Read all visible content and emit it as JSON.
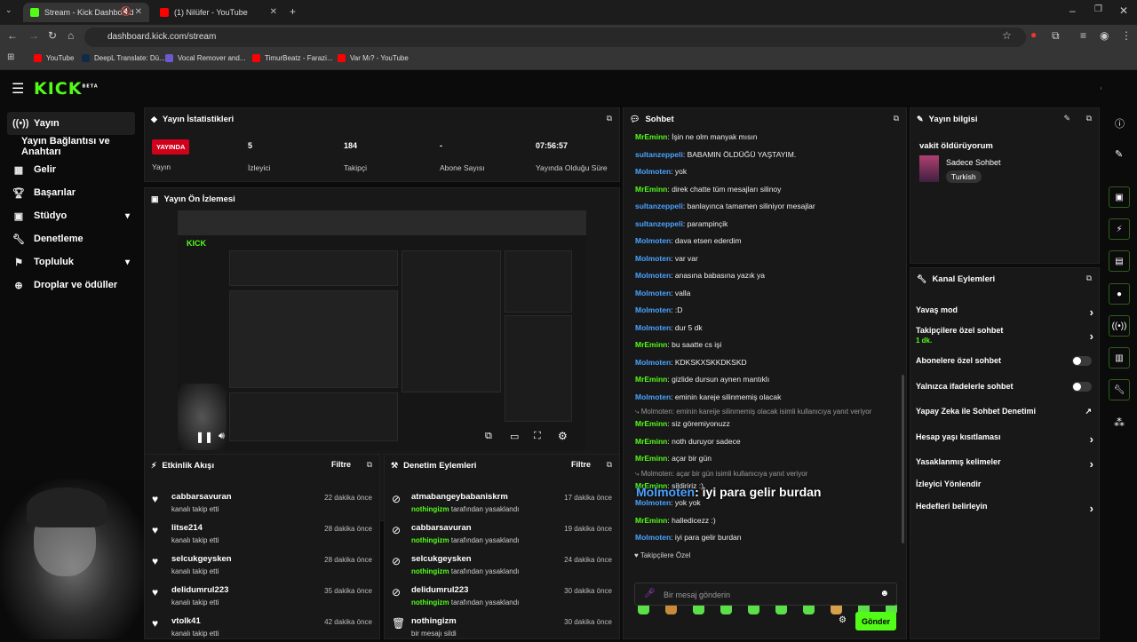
{
  "browser": {
    "tabs": [
      {
        "title": "Stream - Kick Dashboard",
        "active": true,
        "color": "#53fc18"
      },
      {
        "title": "(1) Nilüfer - YouTube",
        "active": false,
        "color": "#ff0000"
      }
    ],
    "url": "dashboard.kick.com/stream",
    "bookmarks": [
      "YouTube",
      "DeepL Translate: Dü...",
      "Vocal Remover and...",
      "TimurBeatz - Farazi...",
      "Var Mı? - YouTube"
    ]
  },
  "logo": {
    "text": "KICK",
    "beta": "BETA"
  },
  "sidebar": {
    "items": [
      {
        "label": "Yayın",
        "icon": "stream-icon",
        "selected": true
      },
      {
        "label": "Yayın Bağlantısı ve Anahtarı",
        "icon": "",
        "selected": false
      },
      {
        "label": "Gelir",
        "icon": "chart-icon"
      },
      {
        "label": "Başarılar",
        "icon": "trophy-icon"
      },
      {
        "label": "Stüdyo",
        "icon": "studio-icon",
        "chevron": true
      },
      {
        "label": "Denetleme",
        "icon": "wrench-icon"
      },
      {
        "label": "Topluluk",
        "icon": "people-icon",
        "chevron": true
      },
      {
        "label": "Droplar ve ödüller",
        "icon": "gift-icon"
      }
    ]
  },
  "stats": {
    "title": "Yayın İstatistikleri",
    "live_badge": "YAYINDA",
    "items": [
      {
        "value": "",
        "label": "Yayın"
      },
      {
        "value": "5",
        "label": "İzleyici"
      },
      {
        "value": "184",
        "label": "Takipçi"
      },
      {
        "value": "-",
        "label": "Abone Sayısı"
      },
      {
        "value": "07:56:57",
        "label": "Yayında Olduğu Süre"
      }
    ]
  },
  "preview": {
    "title": "Yayın Ön İzlemesi"
  },
  "activity": {
    "title": "Etkinlik Akışı",
    "filter": "Filtre",
    "items": [
      {
        "name": "cabbarsavuran",
        "sub": "kanalı takip etti",
        "time": "22 dakika önce"
      },
      {
        "name": "litse214",
        "sub": "kanalı takip etti",
        "time": "28 dakika önce"
      },
      {
        "name": "selcukgeysken",
        "sub": "kanalı takip etti",
        "time": "28 dakika önce"
      },
      {
        "name": "delidumrul223",
        "sub": "kanalı takip etti",
        "time": "35 dakika önce"
      },
      {
        "name": "vtolk41",
        "sub": "kanalı takip etti",
        "time": "42 dakika önce"
      }
    ]
  },
  "moderation": {
    "title": "Denetim Eylemleri",
    "filter": "Filtre",
    "items": [
      {
        "name": "atmabangeybabaniskrm",
        "by": "nothingizm",
        "sub": "tarafından yasaklandı",
        "time": "17 dakika önce"
      },
      {
        "name": "cabbarsavuran",
        "by": "nothingizm",
        "sub": "tarafından yasaklandı",
        "time": "19 dakika önce"
      },
      {
        "name": "selcukgeysken",
        "by": "nothingizm",
        "sub": "tarafından yasaklandı",
        "time": "24 dakika önce"
      },
      {
        "name": "delidumrul223",
        "by": "nothingizm",
        "sub": "tarafından yasaklandı",
        "time": "30 dakika önce"
      },
      {
        "name": "nothingizm",
        "by": "",
        "sub": "bir mesajı sildi",
        "time": "30 dakika önce"
      }
    ]
  },
  "chat": {
    "title": "Sohbet",
    "messages": [
      {
        "user": "MrEminn",
        "color": "#53fc18",
        "text": ": İşin ne olm manyak mısın"
      },
      {
        "user": "sultanzeppeli",
        "color": "#4aa3ff",
        "text": ": BABAMIN ÖLDÜĞÜ YAŞTAYIM."
      },
      {
        "user": "Molmoten",
        "color": "#4aa3ff",
        "text": ": yok"
      },
      {
        "user": "MrEminn",
        "color": "#53fc18",
        "text": ": direk chatte tüm mesajları silinoy"
      },
      {
        "user": "sultanzeppeli",
        "color": "#4aa3ff",
        "text": ": banlayınca tamamen siliniyor mesajlar"
      },
      {
        "user": "sultanzeppeli",
        "color": "#4aa3ff",
        "text": ": parampinçik"
      },
      {
        "user": "Molmoten",
        "color": "#4aa3ff",
        "text": ": dava etsen ederdim"
      },
      {
        "user": "Molmoten",
        "color": "#4aa3ff",
        "text": ": var var"
      },
      {
        "user": "Molmoten",
        "color": "#4aa3ff",
        "text": ": anasına babasına yazık ya"
      },
      {
        "user": "Molmoten",
        "color": "#4aa3ff",
        "text": ": valla"
      },
      {
        "user": "Molmoten",
        "color": "#4aa3ff",
        "text": ": :D"
      },
      {
        "user": "Molmoten",
        "color": "#4aa3ff",
        "text": ": dur 5 dk"
      },
      {
        "user": "MrEminn",
        "color": "#53fc18",
        "text": ": bu saatte cs işi"
      },
      {
        "user": "Molmoten",
        "color": "#4aa3ff",
        "text": ": KDKSKXSKKDKSKD"
      },
      {
        "user": "MrEminn",
        "color": "#53fc18",
        "text": ": gizlide dursun aynen mantıklı"
      },
      {
        "user": "Molmoten",
        "color": "#4aa3ff",
        "text": ": eminin kareje silinmemiş olacak"
      }
    ],
    "reply1": "⤷ Molmoten: eminin kareije silinmemiş olacak isimli kullanıcıya yanıt veriyor",
    "messages2": [
      {
        "user": "MrEminn",
        "color": "#53fc18",
        "text": ": siz göremiyonuzz"
      },
      {
        "user": "MrEminn",
        "color": "#53fc18",
        "text": ": noth duruyor sadece"
      },
      {
        "user": "MrEminn",
        "color": "#53fc18",
        "text": ": açar bir gün"
      }
    ],
    "reply2": "⤷ Molmoten: açar bir gün isimli kullanıcıya yanıt veriyor",
    "messages3": [
      {
        "user": "MrEminn",
        "color": "#53fc18",
        "text": ": sildiririz :)"
      },
      {
        "user": "Molmoten",
        "color": "#4aa3ff",
        "text": ": yok yok"
      },
      {
        "user": "MrEminn",
        "color": "#53fc18",
        "text": ": halledicezz :)"
      },
      {
        "user": "Molmoten",
        "color": "#4aa3ff",
        "text": ": iyi para gelir burdan"
      }
    ],
    "overlay_user": "Molmoten",
    "overlay_text": ": iyi para gelir burdan",
    "followers_only": "Takipçilere Özel",
    "input_placeholder": "Bir mesaj gönderin",
    "send": "Gönder"
  },
  "info": {
    "title": "Yayın bilgisi",
    "stream_title": "vakit öldürüyorum",
    "category": "Sadece Sohbet",
    "tag": "Turkish"
  },
  "actions": {
    "title": "Kanal Eylemleri",
    "items": [
      {
        "label": "Yavaş mod",
        "kind": "chevron"
      },
      {
        "label": "Takipçilere özel sohbet",
        "sub": "1 dk.",
        "kind": "chevron"
      },
      {
        "label": "Abonelere özel sohbet",
        "kind": "toggle"
      },
      {
        "label": "Yalnızca ifadelerle sohbet",
        "kind": "toggle"
      },
      {
        "label": "Yapay Zeka ile Sohbet Denetimi",
        "kind": "external"
      },
      {
        "label": "Hesap yaşı kısıtlaması",
        "kind": "chevron"
      },
      {
        "label": "Yasaklanmış kelimeler",
        "kind": "chevron"
      },
      {
        "label": "İzleyici Yönlendir",
        "kind": "none"
      },
      {
        "label": "Hedefleri belirleyin",
        "kind": "chevron"
      }
    ]
  }
}
